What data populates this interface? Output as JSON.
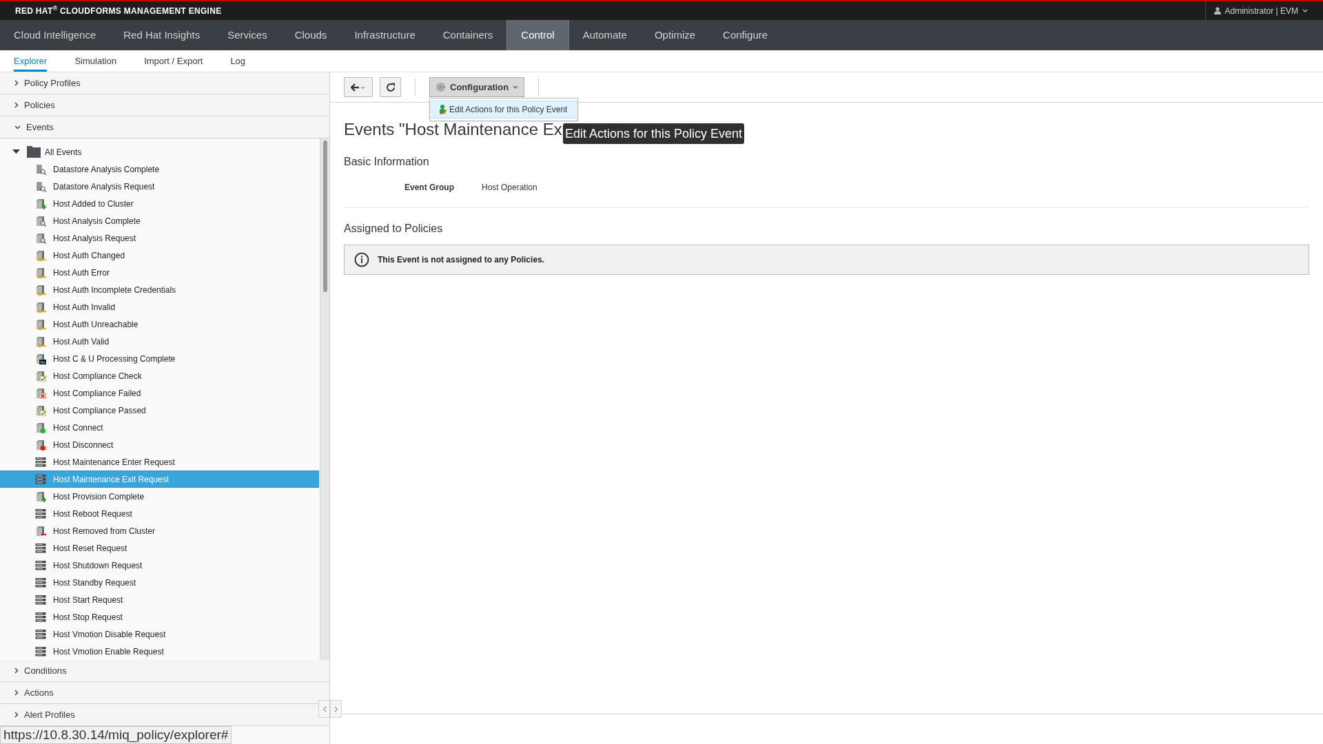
{
  "brand": "RED HAT$^{®}$ CLOUDFORMS MANAGEMENT ENGINE",
  "user": "Administrator | EVM",
  "nav": [
    {
      "label": "Cloud Intelligence",
      "selected": false
    },
    {
      "label": "Red Hat Insights",
      "selected": false
    },
    {
      "label": "Services",
      "selected": false
    },
    {
      "label": "Clouds",
      "selected": false
    },
    {
      "label": "Infrastructure",
      "selected": false
    },
    {
      "label": "Containers",
      "selected": false
    },
    {
      "label": "Control",
      "selected": true
    },
    {
      "label": "Automate",
      "selected": false
    },
    {
      "label": "Optimize",
      "selected": false
    },
    {
      "label": "Configure",
      "selected": false
    }
  ],
  "subnav": [
    {
      "label": "Explorer",
      "selected": true
    },
    {
      "label": "Simulation",
      "selected": false
    },
    {
      "label": "Import / Export",
      "selected": false
    },
    {
      "label": "Log",
      "selected": false
    }
  ],
  "accordion_top": [
    {
      "label": "Policy Profiles",
      "expanded": false
    },
    {
      "label": "Policies",
      "expanded": false
    },
    {
      "label": "Events",
      "expanded": true
    }
  ],
  "tree": {
    "label": "All Events",
    "expanded": true,
    "children": [
      {
        "label": "Datastore Analysis Complete",
        "kind": "datastore",
        "selected": false
      },
      {
        "label": "Datastore Analysis Request",
        "kind": "datastore",
        "selected": false
      },
      {
        "label": "Host Added to Cluster",
        "kind": "hostadd",
        "selected": false
      },
      {
        "label": "Host Analysis Complete",
        "kind": "hostsearch",
        "selected": false
      },
      {
        "label": "Host Analysis Request",
        "kind": "hostsearch",
        "selected": false
      },
      {
        "label": "Host Auth Changed",
        "kind": "hostkey",
        "selected": false
      },
      {
        "label": "Host Auth Error",
        "kind": "hostkey",
        "selected": false
      },
      {
        "label": "Host Auth Incomplete Credentials",
        "kind": "hostkey",
        "selected": false
      },
      {
        "label": "Host Auth Invalid",
        "kind": "hostkey",
        "selected": false
      },
      {
        "label": "Host Auth Unreachable",
        "kind": "hostkey",
        "selected": false
      },
      {
        "label": "Host Auth Valid",
        "kind": "hostkey",
        "selected": false
      },
      {
        "label": "Host C & U Processing Complete",
        "kind": "hostmonitor",
        "selected": false
      },
      {
        "label": "Host Compliance Check",
        "kind": "hostcheck",
        "selected": false
      },
      {
        "label": "Host Compliance Failed",
        "kind": "hostfail",
        "selected": false
      },
      {
        "label": "Host Compliance Passed",
        "kind": "hostcheck",
        "selected": false
      },
      {
        "label": "Host Connect",
        "kind": "hostconnect",
        "selected": false
      },
      {
        "label": "Host Disconnect",
        "kind": "hostdisconnect",
        "selected": false
      },
      {
        "label": "Host Maintenance Enter Request",
        "kind": "rack",
        "selected": false
      },
      {
        "label": "Host Maintenance Exit Request",
        "kind": "rack",
        "selected": true
      },
      {
        "label": "Host Provision Complete",
        "kind": "hostadd",
        "selected": false
      },
      {
        "label": "Host Reboot Request",
        "kind": "rack",
        "selected": false
      },
      {
        "label": "Host Removed from Cluster",
        "kind": "hostremove",
        "selected": false
      },
      {
        "label": "Host Reset Request",
        "kind": "rack",
        "selected": false
      },
      {
        "label": "Host Shutdown Request",
        "kind": "rack",
        "selected": false
      },
      {
        "label": "Host Standby Request",
        "kind": "rack",
        "selected": false
      },
      {
        "label": "Host Start Request",
        "kind": "rack",
        "selected": false
      },
      {
        "label": "Host Stop Request",
        "kind": "rack",
        "selected": false
      },
      {
        "label": "Host Vmotion Disable Request",
        "kind": "rack",
        "selected": false
      },
      {
        "label": "Host Vmotion Enable Request",
        "kind": "rack",
        "selected": false
      }
    ]
  },
  "accordion_bottom": [
    {
      "label": "Conditions",
      "expanded": false
    },
    {
      "label": "Actions",
      "expanded": false
    },
    {
      "label": "Alert Profiles",
      "expanded": false
    }
  ],
  "toolbar": {
    "configuration": "Configuration",
    "menu_items": [
      "Edit Actions for this Policy Event"
    ],
    "tooltip": "Edit Actions for this Policy Event"
  },
  "content": {
    "title": "Events \"Host Maintenance Ex",
    "sections": [
      {
        "heading": "Basic Information",
        "fields": [
          {
            "label": "Event Group",
            "value": "Host Operation"
          }
        ]
      },
      {
        "heading": "Assigned to Policies",
        "alert": "This Event is not assigned to any Policies."
      }
    ]
  },
  "status_url": "https://10.8.30.14/miq_policy/explorer#"
}
